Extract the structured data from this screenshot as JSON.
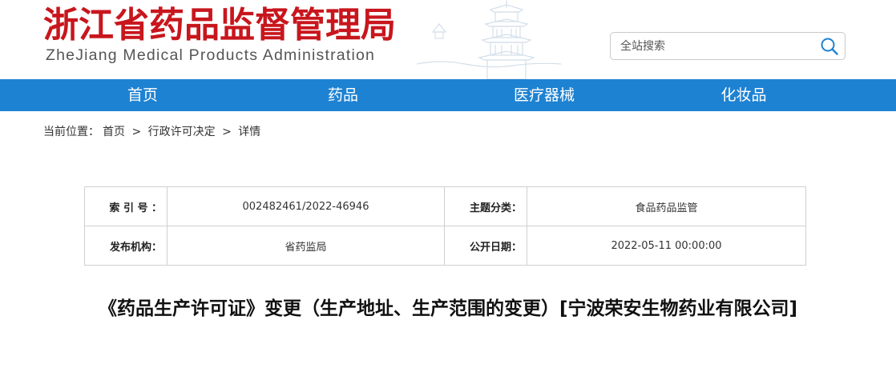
{
  "header": {
    "title_cn": "浙江省药品监督管理局",
    "title_en": "ZheJiang Medical Products Administration"
  },
  "search": {
    "placeholder": "全站搜索",
    "icon": "search-icon"
  },
  "nav": {
    "items": [
      {
        "label": "首页"
      },
      {
        "label": "药品"
      },
      {
        "label": "医疗器械"
      },
      {
        "label": "化妆品"
      }
    ]
  },
  "breadcrumb": {
    "prefix": "当前位置：",
    "items": [
      "首页",
      "行政许可决定",
      "详情"
    ],
    "separator": ">"
  },
  "meta": {
    "index_label": "索 引 号 ：",
    "index_value": "002482461/2022-46946",
    "topic_label": "主题分类：",
    "topic_value": "食品药品监管",
    "publisher_label": "发布机构：",
    "publisher_value": "省药监局",
    "date_label": "公开日期：",
    "date_value": "2022-05-11 00:00:00"
  },
  "document": {
    "title": "《药品生产许可证》变更（生产地址、生产范围的变更）[宁波荣安生物药业有限公司]"
  },
  "colors": {
    "brand_red": "#c8161d",
    "nav_blue": "#1e82d2"
  }
}
